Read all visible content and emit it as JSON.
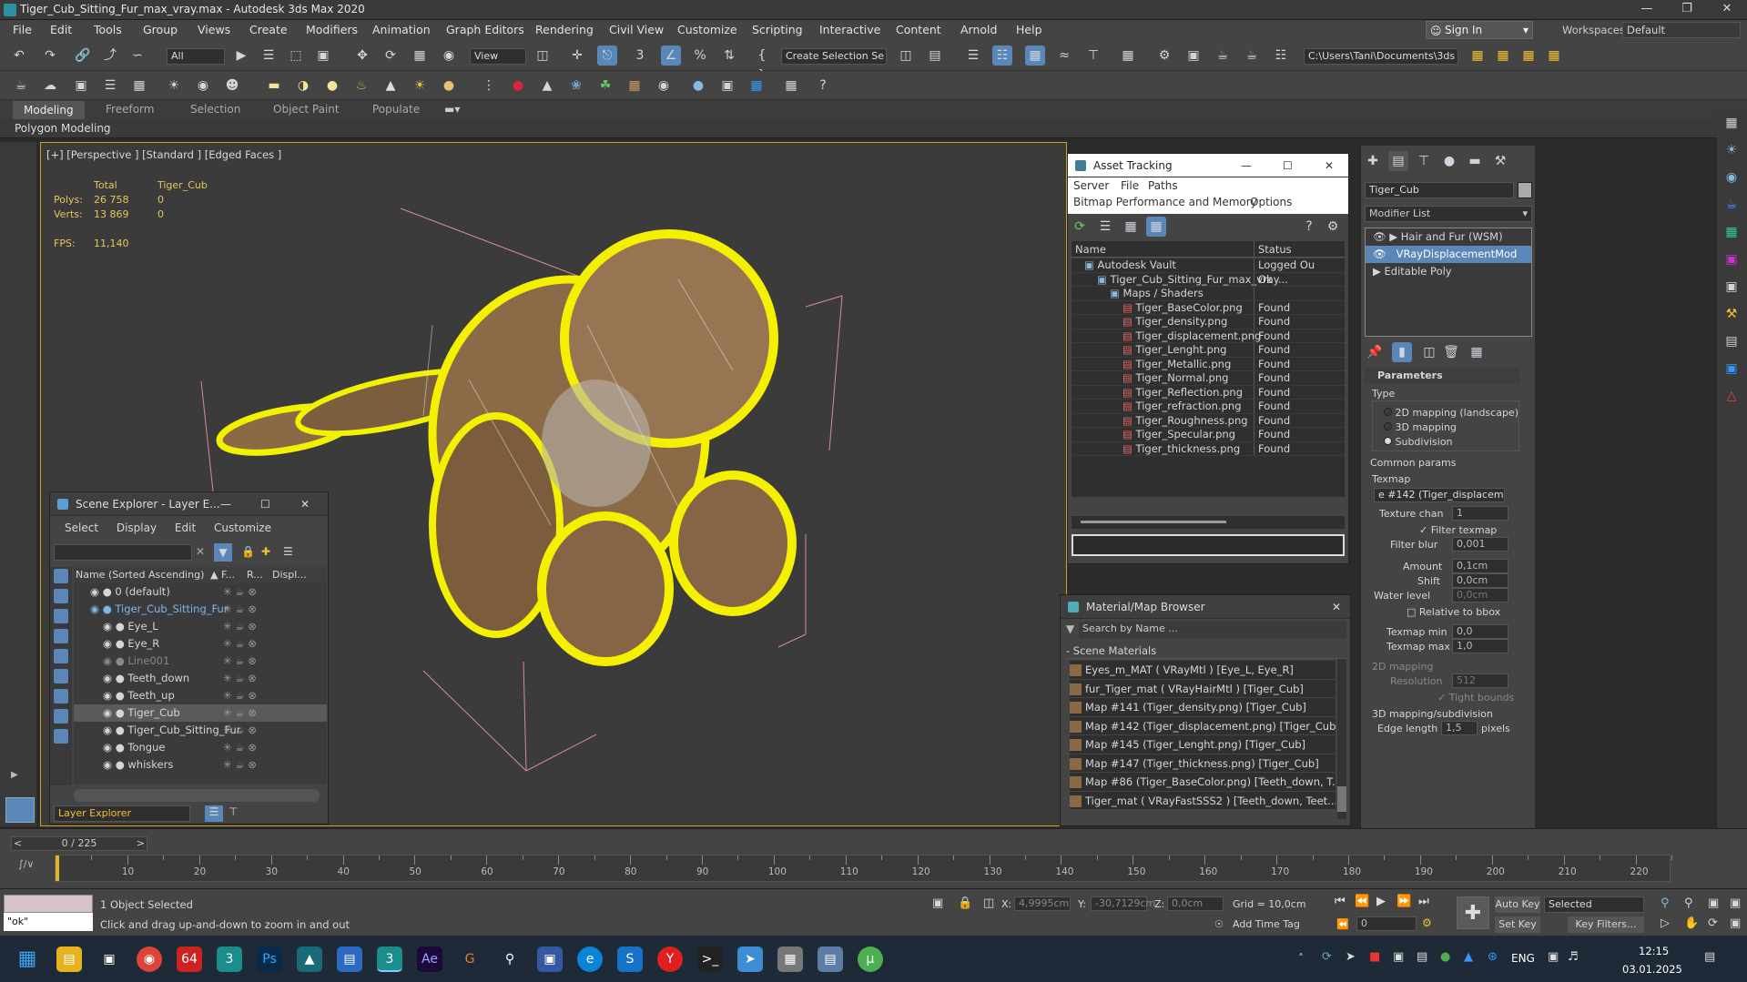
{
  "window": {
    "title": "Tiger_Cub_Sitting_Fur_max_vray.max - Autodesk 3ds Max 2020"
  },
  "menu": [
    "File",
    "Edit",
    "Tools",
    "Group",
    "Views",
    "Create",
    "Modifiers",
    "Animation",
    "Graph Editors",
    "Rendering",
    "Civil View",
    "Customize",
    "Scripting",
    "Interactive",
    "Content",
    "Arnold",
    "Help"
  ],
  "account": {
    "sign_in": "Sign In",
    "workspaces_label": "Workspaces:",
    "workspace": "Default"
  },
  "toolbar": {
    "filter": "All",
    "ref_coord": "View",
    "selection_set": "Create Selection Se",
    "project_path": "C:\\Users\\Tani\\Documents\\3ds Max 2020"
  },
  "ribbon": {
    "tabs": [
      "Modeling",
      "Freeform",
      "Selection",
      "Object Paint",
      "Populate"
    ],
    "sub": "Polygon Modeling"
  },
  "viewport": {
    "label": "[+] [Perspective ] [Standard ] [Edged Faces ]",
    "stats": {
      "total_label": "Total",
      "object_label": "Tiger_Cub",
      "polys_label": "Polys:",
      "polys_total": "26 758",
      "polys_obj": "0",
      "verts_label": "Verts:",
      "verts_total": "13 869",
      "verts_obj": "0",
      "fps_label": "FPS:",
      "fps": "11,140"
    }
  },
  "scene_explorer": {
    "title": "Scene Explorer - Layer E...",
    "menu": [
      "Select",
      "Display",
      "Edit",
      "Customize"
    ],
    "columns": [
      "Name (Sorted Ascending)",
      "F...",
      "R...",
      "Displ..."
    ],
    "rows": [
      {
        "name": "0 (default)",
        "indent": 1
      },
      {
        "name": "Tiger_Cub_Sitting_Fur",
        "indent": 1,
        "highlight": true
      },
      {
        "name": "Eye_L",
        "indent": 2
      },
      {
        "name": "Eye_R",
        "indent": 2
      },
      {
        "name": "Line001",
        "indent": 2,
        "dim": true
      },
      {
        "name": "Teeth_down",
        "indent": 2
      },
      {
        "name": "Teeth_up",
        "indent": 2
      },
      {
        "name": "Tiger_Cub",
        "indent": 2,
        "selected": true
      },
      {
        "name": "Tiger_Cub_Sitting_Fur",
        "indent": 2
      },
      {
        "name": "Tongue",
        "indent": 2
      },
      {
        "name": "whiskers",
        "indent": 2
      }
    ],
    "footer": "Layer Explorer"
  },
  "asset_tracking": {
    "title": "Asset Tracking",
    "menu1": [
      "Server",
      "File",
      "Paths"
    ],
    "menu2": [
      "Bitmap Performance and Memory",
      "Options"
    ],
    "columns": [
      "Name",
      "Status"
    ],
    "rows": [
      {
        "name": "Autodesk Vault",
        "status": "Logged Ou",
        "indent": 1
      },
      {
        "name": "Tiger_Cub_Sitting_Fur_max_vray...",
        "status": "Ok",
        "indent": 2
      },
      {
        "name": "Maps / Shaders",
        "status": "",
        "indent": 3
      },
      {
        "name": "Tiger_BaseColor.png",
        "status": "Found",
        "indent": 4
      },
      {
        "name": "Tiger_density.png",
        "status": "Found",
        "indent": 4
      },
      {
        "name": "Tiger_displacement.png",
        "status": "Found",
        "indent": 4
      },
      {
        "name": "Tiger_Lenght.png",
        "status": "Found",
        "indent": 4
      },
      {
        "name": "Tiger_Metallic.png",
        "status": "Found",
        "indent": 4
      },
      {
        "name": "Tiger_Normal.png",
        "status": "Found",
        "indent": 4
      },
      {
        "name": "Tiger_Reflection.png",
        "status": "Found",
        "indent": 4
      },
      {
        "name": "Tiger_refraction.png",
        "status": "Found",
        "indent": 4
      },
      {
        "name": "Tiger_Roughness.png",
        "status": "Found",
        "indent": 4
      },
      {
        "name": "Tiger_Specular.png",
        "status": "Found",
        "indent": 4
      },
      {
        "name": "Tiger_thickness.png",
        "status": "Found",
        "indent": 4
      }
    ]
  },
  "material_browser": {
    "title": "Material/Map Browser",
    "search_placeholder": "Search by Name ...",
    "section": "- Scene Materials",
    "items": [
      "Eyes_m_MAT  ( VRayMtl ) [Eye_L, Eye_R]",
      "fur_Tiger_mat  ( VRayHairMtl ) [Tiger_Cub]",
      "Map #141 (Tiger_density.png) [Tiger_Cub]",
      "Map #142 (Tiger_displacement.png) [Tiger_Cub]",
      "Map #145 (Tiger_Lenght.png) [Tiger_Cub]",
      "Map #147 (Tiger_thickness.png) [Tiger_Cub]",
      "Map #86 (Tiger_BaseColor.png) [Teeth_down, T...",
      "Tiger_mat  ( VRayFastSSS2 ) [Teeth_down, Teet..."
    ]
  },
  "command_panel": {
    "object_name": "Tiger_Cub",
    "modifier_list": "Modifier List",
    "stack": [
      "Hair and Fur (WSM)",
      "VRayDisplacementMod",
      "Editable Poly"
    ],
    "params_title": "Parameters",
    "type_label": "Type",
    "types": [
      "2D mapping (landscape)",
      "3D mapping",
      "Subdivision"
    ],
    "common_params": "Common params",
    "texmap_label": "Texmap",
    "texmap_value": "e #142 (Tiger_displacement.p",
    "texture_chan_label": "Texture chan",
    "texture_chan": "1",
    "filter_texmap": "Filter texmap",
    "filter_blur_label": "Filter blur",
    "filter_blur": "0,001",
    "amount_label": "Amount",
    "amount": "0,1cm",
    "shift_label": "Shift",
    "shift": "0,0cm",
    "water_label": "Water level",
    "water": "0,0cm",
    "relative_bbox": "Relative to bbox",
    "texmap_min_label": "Texmap min",
    "texmap_min": "0,0",
    "texmap_max_label": "Texmap max",
    "texmap_max": "1,0",
    "mapping2d": "2D mapping",
    "resolution_label": "Resolution",
    "resolution": "512",
    "tight_bounds": "Tight bounds",
    "mapping3d": "3D mapping/subdivision",
    "edge_length_label": "Edge length",
    "edge_length": "1,5",
    "pixels": "pixels"
  },
  "timeline": {
    "frame": "0 / 225",
    "ticks": [
      "10",
      "20",
      "30",
      "40",
      "50",
      "60",
      "70",
      "80",
      "90",
      "100",
      "110",
      "120",
      "130",
      "140",
      "150",
      "160",
      "170",
      "180",
      "190",
      "200",
      "210",
      "220"
    ]
  },
  "status": {
    "script_value": "\"ok\"",
    "selected": "1 Object Selected",
    "hint": "Click and drag up-and-down to zoom in and out",
    "x_label": "X:",
    "x": "4,9995cm",
    "y_label": "Y:",
    "y": "-30,7129cm",
    "z_label": "Z:",
    "z": "0,0cm",
    "grid": "Grid = 10,0cm",
    "add_time_tag": "Add Time Tag",
    "auto_key": "Auto Key",
    "set_key": "Set Key",
    "selected_dd": "Selected",
    "key_filters": "Key Filters...",
    "frame_field": "0"
  },
  "taskbar": {
    "lang": "ENG",
    "time": "12:15",
    "date": "03.01.2025"
  }
}
